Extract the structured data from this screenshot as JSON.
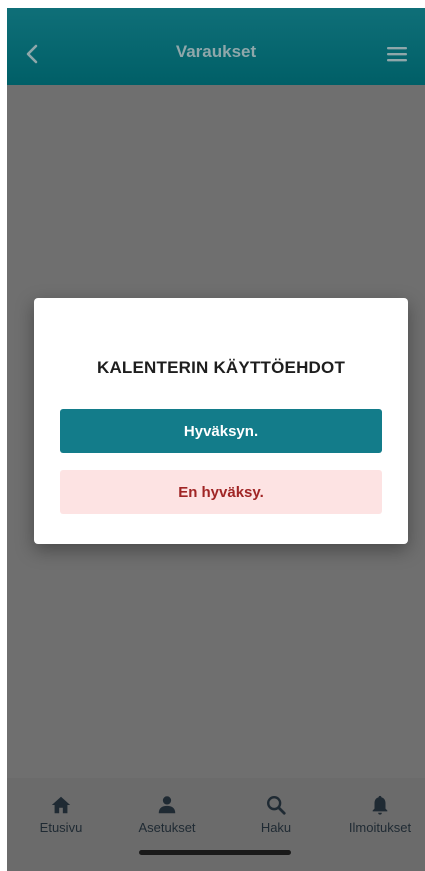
{
  "header": {
    "title": "Varaukset",
    "back_icon": "chevron-left-icon",
    "menu_icon": "hamburger-menu-icon"
  },
  "dialog": {
    "title": "KALENTERIN KÄYTTÖEHDOT",
    "accept_label": "Hyväksyn.",
    "decline_label": "En hyväksy."
  },
  "tabbar": {
    "items": [
      {
        "label": "Etusivu",
        "icon": "home-icon"
      },
      {
        "label": "Asetukset",
        "icon": "user-icon"
      },
      {
        "label": "Haku",
        "icon": "search-icon"
      },
      {
        "label": "Ilmoitukset",
        "icon": "bell-icon"
      }
    ]
  },
  "colors": {
    "header": "#005f67",
    "accept": "#137c8a",
    "decline_bg": "#fde3e3",
    "decline_text": "#a02525",
    "overlay": "#6f6f6f"
  }
}
